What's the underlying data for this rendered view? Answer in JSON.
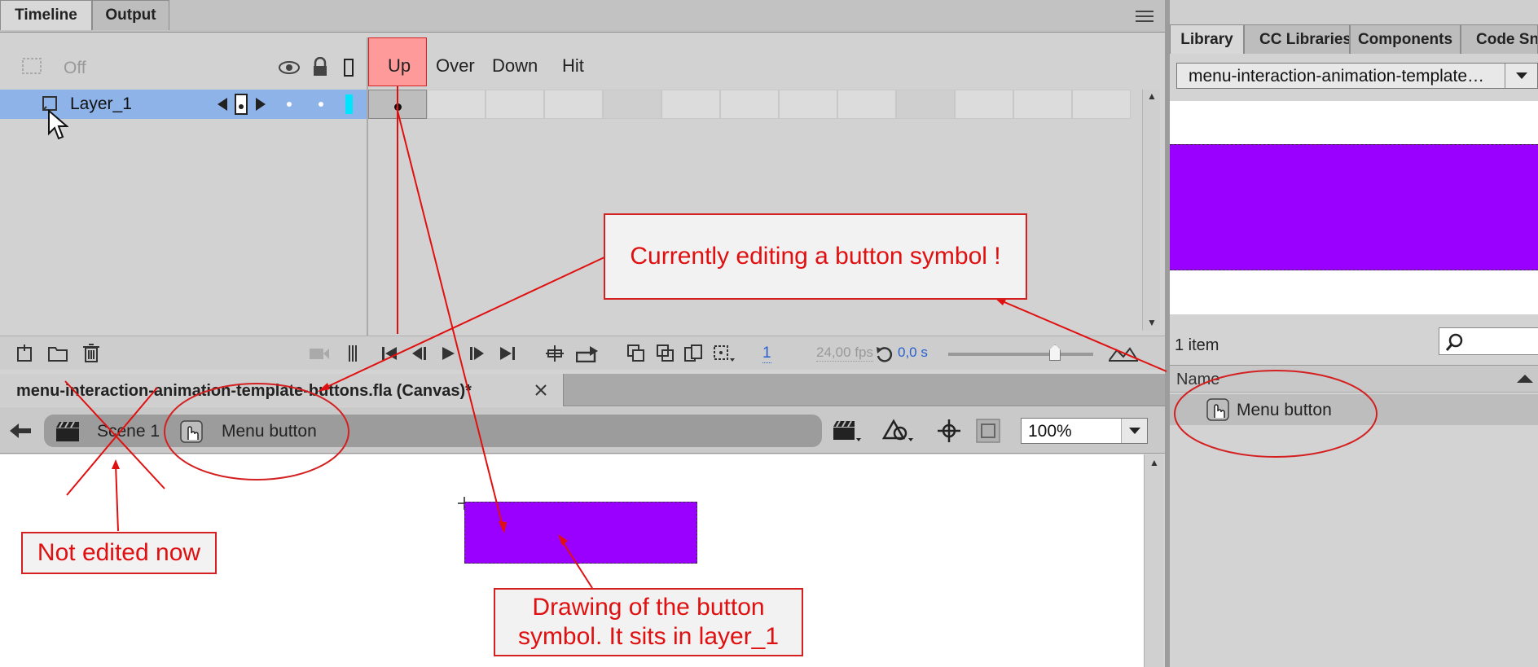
{
  "timeline": {
    "tabs": [
      "Timeline",
      "Output"
    ],
    "camera_label": "Off",
    "layer_name": "Layer_1",
    "frame_labels": [
      "Up",
      "Over",
      "Down",
      "Hit"
    ],
    "current_frame": "1",
    "fps": "24,00 fps",
    "time": "0,0 s"
  },
  "library": {
    "tabs": [
      "Library",
      "CC Libraries",
      "Components",
      "Code Snip"
    ],
    "document_select": "menu-interaction-animation-template…",
    "item_count": "1 item",
    "column_name": "Name",
    "items": [
      {
        "name": "Menu button"
      }
    ]
  },
  "stage": {
    "doc_tab": "menu-interaction-animation-template-buttons.fla (Canvas)*",
    "breadcrumb_scene": "Scene 1",
    "breadcrumb_symbol": "Menu button",
    "zoom": "100%"
  },
  "annotations": {
    "editing_note": "Currently editing a button symbol !",
    "not_edited_note": "Not edited now",
    "drawing_note_line1": "Drawing of the button",
    "drawing_note_line2": "symbol. It sits in layer_1"
  },
  "colors": {
    "symbol_fill": "#9a00ff",
    "layer_highlight": "#8db3e8",
    "current_frame_label_bg": "#ff9a9a",
    "annotation_red": "#e01010"
  }
}
